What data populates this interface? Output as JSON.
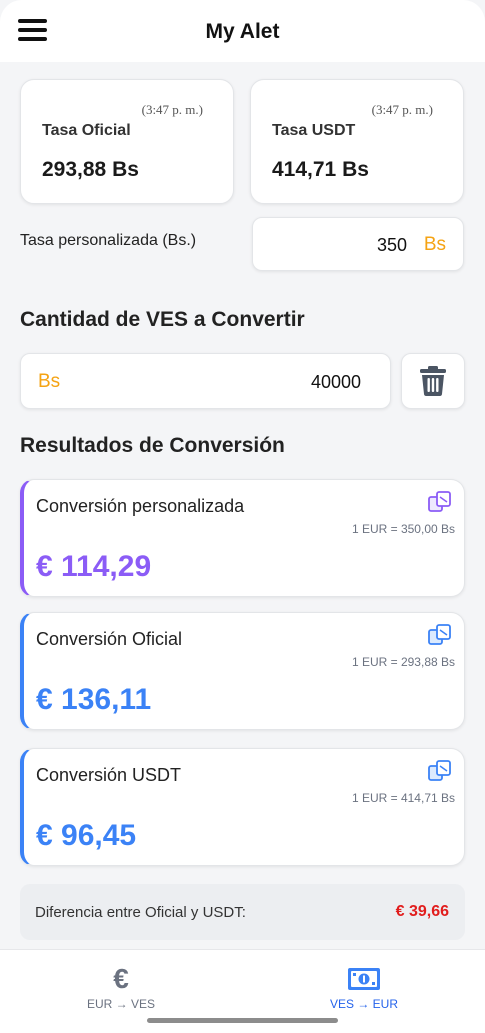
{
  "app": {
    "title": "My Alet"
  },
  "colors": {
    "accent_orange": "#f5a313",
    "custom_purple": "#8b5cf6",
    "official_blue": "#3b82f6",
    "diff_red": "#e11d1d"
  },
  "rates": {
    "official": {
      "time": "(3:47 p. m.)",
      "label": "Tasa Oficial",
      "value": "293,88 Bs"
    },
    "usdt": {
      "time": "(3:47 p. m.)",
      "label": "Tasa USDT",
      "value": "414,71 Bs"
    }
  },
  "custom_rate": {
    "label": "Tasa personalizada (Bs.)",
    "value": "350",
    "unit": "Bs"
  },
  "amount": {
    "section_title": "Cantidad de VES a Convertir",
    "unit": "Bs",
    "value": "40000"
  },
  "results": {
    "section_title": "Resultados de Conversión",
    "items": [
      {
        "title": "Conversión personalizada",
        "rate": "1 EUR = 350,00 Bs",
        "amount": "€ 114,29",
        "color": "#8b5cf6"
      },
      {
        "title": "Conversión Oficial",
        "rate": "1 EUR = 293,88 Bs",
        "amount": "€ 136,11",
        "color": "#3b82f6"
      },
      {
        "title": "Conversión USDT",
        "rate": "1 EUR = 414,71 Bs",
        "amount": "€ 96,45",
        "color": "#3b82f6"
      }
    ]
  },
  "difference": {
    "label": "Diferencia entre Oficial y USDT:",
    "value": "€ 39,66"
  },
  "nav": {
    "items": [
      {
        "label": "EUR → VES",
        "icon": "euro-icon",
        "active": false
      },
      {
        "label": "VES → EUR",
        "icon": "banknote-icon",
        "active": true
      }
    ]
  }
}
